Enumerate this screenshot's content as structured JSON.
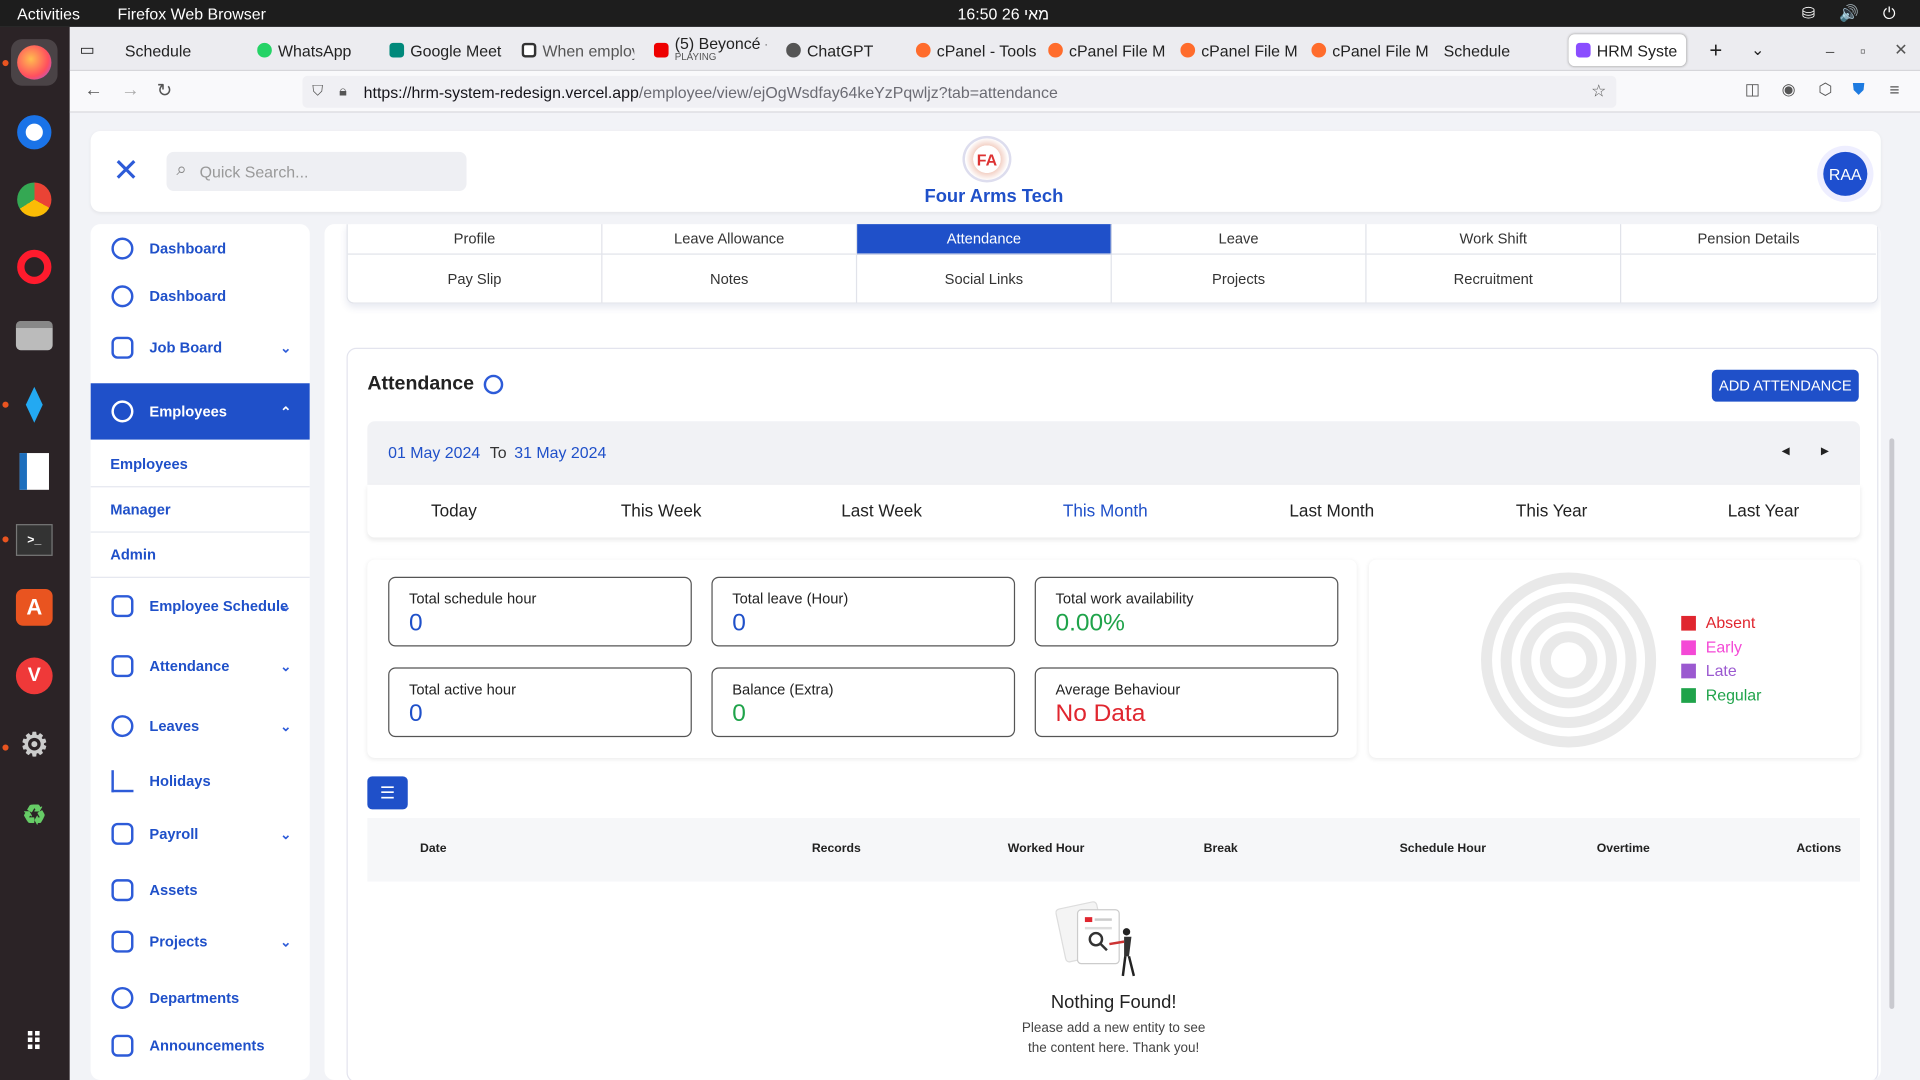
{
  "os": {
    "activities": "Activities",
    "app_name": "Firefox Web Browser",
    "clock": "מאי 26  16:50"
  },
  "browser": {
    "tabs": [
      {
        "label": "Schedule",
        "fav": "#888"
      },
      {
        "label": "WhatsApp",
        "fav": "#25d366"
      },
      {
        "label": "Google Meet",
        "fav": "#00897b"
      },
      {
        "label": "When employ",
        "fav": "#333"
      },
      {
        "label": "(5) Beyoncé -",
        "sub": "PLAYING",
        "fav": "#e00"
      },
      {
        "label": "ChatGPT",
        "fav": "#555"
      },
      {
        "label": "cPanel - Tools",
        "fav": "#ff6c2c"
      },
      {
        "label": "cPanel File M",
        "fav": "#ff6c2c"
      },
      {
        "label": "cPanel File M",
        "fav": "#ff6c2c"
      },
      {
        "label": "cPanel File M",
        "fav": "#ff6c2c"
      },
      {
        "label": "Schedule",
        "fav": ""
      },
      {
        "label": "HRM Syste",
        "fav": "#8a4dff"
      }
    ],
    "url_host": "https://hrm-system-redesign.vercel.app",
    "url_path": "/employee/view/ejOgWsdfay64keYzPqwljz?tab=attendance"
  },
  "header": {
    "search_placeholder": "Quick Search...",
    "brand": "Four Arms Tech",
    "logo_text": "FA",
    "avatar": "RAA"
  },
  "sidebar": {
    "items": [
      {
        "label": "Dashboard",
        "chev": ""
      },
      {
        "label": "Dashboard",
        "chev": ""
      },
      {
        "label": "Job Board",
        "chev": "⌄"
      },
      {
        "label": "Employees",
        "chev": "⌃"
      },
      {
        "label": "Employee Schedule",
        "chev": "⌄"
      },
      {
        "label": "Attendance",
        "chev": "⌄"
      },
      {
        "label": "Leaves",
        "chev": "⌄"
      },
      {
        "label": "Holidays",
        "chev": ""
      },
      {
        "label": "Payroll",
        "chev": "⌄"
      },
      {
        "label": "Assets",
        "chev": ""
      },
      {
        "label": "Projects",
        "chev": "⌄"
      },
      {
        "label": "Departments",
        "chev": ""
      },
      {
        "label": "Announcements",
        "chev": ""
      }
    ],
    "sub_items": [
      "Employees",
      "Manager",
      "Admin"
    ]
  },
  "profile_tabs": [
    "Profile",
    "Leave Allowance",
    "Attendance",
    "Leave",
    "Work Shift",
    "Pension Details",
    "Pay Slip",
    "Notes",
    "Social Links",
    "Projects",
    "Recruitment",
    ""
  ],
  "attendance": {
    "title": "Attendance",
    "add_button": "ADD ATTENDANCE",
    "date_from": "01 May 2024",
    "date_to_label": "To",
    "date_to": "31 May 2024",
    "periods": [
      "Today",
      "This Week",
      "Last Week",
      "This Month",
      "Last Month",
      "This Year",
      "Last Year"
    ],
    "selected_period": "This Month",
    "stats": [
      {
        "label": "Total schedule hour",
        "value": "0",
        "color": "#1f50c9"
      },
      {
        "label": "Total leave (Hour)",
        "value": "0",
        "color": "#1f50c9"
      },
      {
        "label": "Total work availability",
        "value": "0.00%",
        "color": "#1fa34a"
      },
      {
        "label": "Total active hour",
        "value": "0",
        "color": "#1f50c9"
      },
      {
        "label": "Balance (Extra)",
        "value": "0",
        "color": "#1fa34a"
      },
      {
        "label": "Average Behaviour",
        "value": "No Data",
        "color": "#e0262f"
      }
    ],
    "legend": [
      {
        "label": "Absent",
        "color": "#e0262f"
      },
      {
        "label": "Early",
        "color": "#f449d6"
      },
      {
        "label": "Late",
        "color": "#9b59d0"
      },
      {
        "label": "Regular",
        "color": "#1fa34a"
      }
    ],
    "table_headers": [
      "Date",
      "Records",
      "Worked Hour",
      "Break",
      "Schedule Hour",
      "Overtime",
      "Actions"
    ],
    "empty_title": "Nothing Found!",
    "empty_line1": "Please add a new entity to see",
    "empty_line2": "the content here. Thank you!"
  }
}
